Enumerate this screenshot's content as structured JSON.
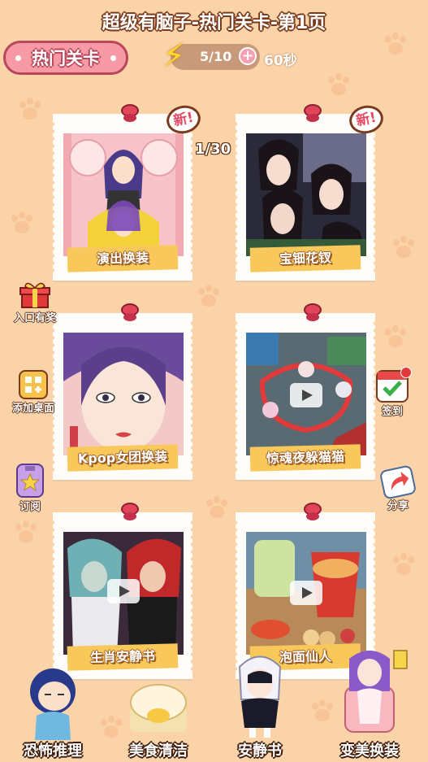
{
  "header": {
    "title": "超级有脑子-热门关卡-第1页"
  },
  "hot_badge": {
    "label": "热门关卡"
  },
  "energy": {
    "count": "5/10",
    "timer": "60秒"
  },
  "page_indicator": "1/30",
  "new_badge_label": "新!",
  "levels": [
    {
      "title": "演出换装",
      "is_new": true,
      "video": false
    },
    {
      "title": "宝钿花钗",
      "is_new": true,
      "video": false
    },
    {
      "title": "Kpop女团换装",
      "is_new": false,
      "video": false
    },
    {
      "title": "惊魂夜躲猫猫",
      "is_new": false,
      "video": true
    },
    {
      "title": "生肖安静书",
      "is_new": false,
      "video": true
    },
    {
      "title": "泡面仙人",
      "is_new": false,
      "video": true
    }
  ],
  "side_buttons": {
    "entry_reward": "入口有奖",
    "add_desktop": "添加桌面",
    "subscribe": "订阅",
    "sign_in": "签到",
    "share": "分享"
  },
  "bottom_dock": [
    {
      "label": "恐怖推理"
    },
    {
      "label": "美食清洁"
    },
    {
      "label": "安静书"
    },
    {
      "label": "变美换装"
    }
  ],
  "colors": {
    "background": "#fbd3a9",
    "badge_pink": "#f89aa6",
    "label_yellow": "#f8c85a",
    "pin_red": "#e2445a"
  }
}
